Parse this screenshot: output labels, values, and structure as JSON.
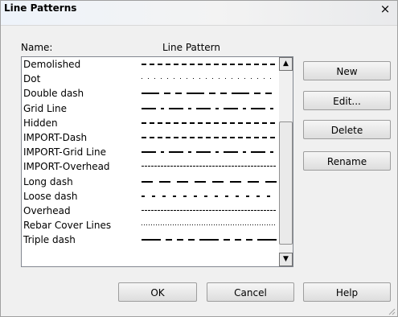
{
  "window": {
    "title": "Line Patterns",
    "close_glyph": "×"
  },
  "columns": {
    "name": "Name:",
    "pattern": "Line Pattern"
  },
  "patterns": [
    {
      "name": "Demolished",
      "style": "dash-long"
    },
    {
      "name": "Dot",
      "style": "dot"
    },
    {
      "name": "Double dash",
      "style": "double-dash"
    },
    {
      "name": "Grid Line",
      "style": "dash-dot"
    },
    {
      "name": "Hidden",
      "style": "dash-long"
    },
    {
      "name": "IMPORT-Dash",
      "style": "dash-long"
    },
    {
      "name": "IMPORT-Grid Line",
      "style": "dash-dot"
    },
    {
      "name": "IMPORT-Overhead",
      "style": "dash-small"
    },
    {
      "name": "Long dash",
      "style": "long-dash"
    },
    {
      "name": "Loose dash",
      "style": "loose-dash"
    },
    {
      "name": "Overhead",
      "style": "dash-small"
    },
    {
      "name": "Rebar Cover Lines",
      "style": "dot-dense"
    },
    {
      "name": "Triple dash",
      "style": "triple-dash"
    }
  ],
  "buttons": {
    "new": "New",
    "edit": "Edit...",
    "delete": "Delete",
    "rename": "Rename",
    "ok": "OK",
    "cancel": "Cancel",
    "help": "Help"
  },
  "scrollbar": {
    "up_glyph": "▲",
    "down_glyph": "▼"
  }
}
